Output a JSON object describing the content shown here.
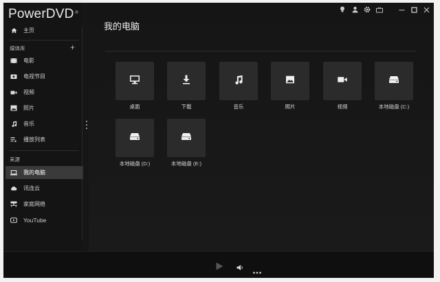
{
  "app": {
    "brand": "PowerDVD"
  },
  "sidebar": {
    "home": "主页",
    "library_label": "媒体库",
    "library_items": [
      {
        "label": "电影",
        "icon": "film-icon"
      },
      {
        "label": "电视节目",
        "icon": "tv-icon"
      },
      {
        "label": "视频",
        "icon": "video-icon"
      },
      {
        "label": "照片",
        "icon": "photo-icon"
      },
      {
        "label": "音乐",
        "icon": "music-icon"
      },
      {
        "label": "播放列表",
        "icon": "playlist-icon"
      }
    ],
    "source_label": "来源",
    "source_items": [
      {
        "label": "我的电脑",
        "icon": "computer-icon",
        "active": true
      },
      {
        "label": "讯连云",
        "icon": "cloud-icon"
      },
      {
        "label": "家庭网络",
        "icon": "network-icon"
      },
      {
        "label": "YouTube",
        "icon": "youtube-icon"
      }
    ]
  },
  "main": {
    "title": "我的电脑",
    "tiles": [
      {
        "label": "桌面",
        "icon": "desktop-icon"
      },
      {
        "label": "下载",
        "icon": "download-icon"
      },
      {
        "label": "音乐",
        "icon": "music-icon"
      },
      {
        "label": "照片",
        "icon": "photo-icon"
      },
      {
        "label": "视频",
        "icon": "video-camera-icon"
      },
      {
        "label": "本地磁盘 (C:)",
        "icon": "drive-icon"
      },
      {
        "label": "本地磁盘 (D:)",
        "icon": "drive-icon"
      },
      {
        "label": "本地磁盘 (E:)",
        "icon": "drive-icon"
      }
    ]
  },
  "colors": {
    "background": "#161616",
    "tile": "#2b2b2b",
    "active_item": "#3a3a3a",
    "text": "#dddddd"
  }
}
